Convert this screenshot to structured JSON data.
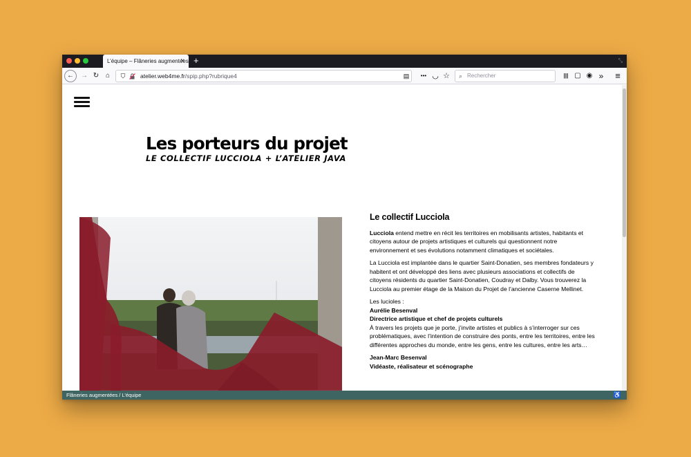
{
  "browser": {
    "tab_title": "L’équipe – Flâneries augmentées",
    "tab_close": "×",
    "new_tab": "+",
    "url_host": "atelier.web4me.fr",
    "url_path": "/spip.php?rubrique4",
    "search_placeholder": "Rechercher",
    "icons": {
      "back": "←",
      "forward": "→",
      "reload": "↻",
      "home": "⌂",
      "shield": "⛉",
      "reader": "▤",
      "more": "•••",
      "pocket": "◡",
      "bookmark": "☆",
      "search": "⌕",
      "library": "|||",
      "sidebar": "▢",
      "account": "◉",
      "overflow": "»",
      "menu": "≡",
      "resize": "⤡"
    },
    "window_dot_colors": [
      "#ff5f57",
      "#febc2e",
      "#28c840"
    ]
  },
  "page": {
    "title": "Les porteurs du projet",
    "subtitle": "LE COLLECTIF LUCCIOLA + L’ATELIER JAVA",
    "accent_color": "#8a1c2a"
  },
  "article": {
    "heading": "Le collectif Lucciola",
    "p1_bold": "Lucciola",
    "p1_text": " entend mettre en récit les territoires en mobilisants artistes, habitants et citoyens autour de projets artistiques et culturels qui questionnent notre environnement et ses évolutions notamment climatiques et sociétales.",
    "p2": "La Lucciola est implantée dans le quartier Saint-Donatien, ses membres fondateurs y habitent et ont développé des liens avec plusieurs associations et collectifs de citoyens résidents du quartier Saint-Donatien, Coudray et Dalby. Vous trouverez la Lucciola au premier étage de la Maison du Projet de l’ancienne Caserne Mellinet.",
    "lucioles_label": "Les lucioles :",
    "member1_name": "Aurélie Besenval",
    "member1_role": "Directrice artistique et chef de projets culturels",
    "member1_text": "À travers les projets que je porte, j’invite artistes et publics à s’interroger sur ces problématiques, avec l’intention de construire des ponts, entre les territoires, entre les différentes approches du monde, entre les gens, entre les cultures, entre les arts…",
    "member2_name": "Jean-Marc Besenval",
    "member2_role": "Vidéaste, réalisateur et scénographe"
  },
  "status": {
    "breadcrumb": "Flâneries augmentées / L’équipe",
    "accessibility_icon": "♿"
  }
}
